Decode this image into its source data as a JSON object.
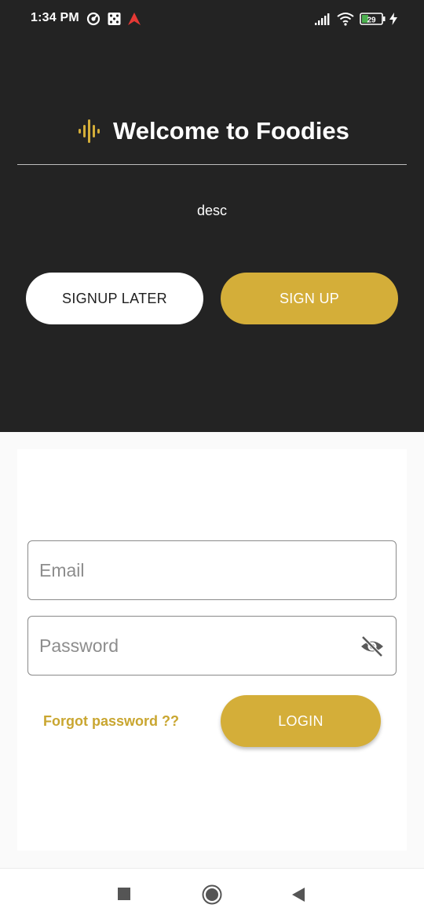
{
  "status_bar": {
    "time": "1:34 PM",
    "battery": "29",
    "left_icons": [
      "sync-icon",
      "dice-icon",
      "red-arrow-icon"
    ],
    "right_icons": [
      "signal-icon",
      "wifi-icon",
      "battery-icon",
      "charging-icon"
    ]
  },
  "header": {
    "title": "Welcome to Foodies",
    "description": "desc",
    "icon": "soundwave-icon"
  },
  "actions": {
    "signup_later_label": "SIGNUP LATER",
    "signup_label": "SIGN UP"
  },
  "login_form": {
    "email_placeholder": "Email",
    "email_value": "",
    "password_placeholder": "Password",
    "password_value": "",
    "toggle_icon": "eye-off-icon",
    "forgot_label": "Forgot password ??",
    "login_label": "LOGIN"
  },
  "nav_bar": {
    "icons": [
      "recents-square-icon",
      "home-circle-icon",
      "back-triangle-icon"
    ]
  },
  "colors": {
    "accent": "#d4ae39",
    "dark_background": "#232323",
    "light_background": "#fafafa"
  }
}
